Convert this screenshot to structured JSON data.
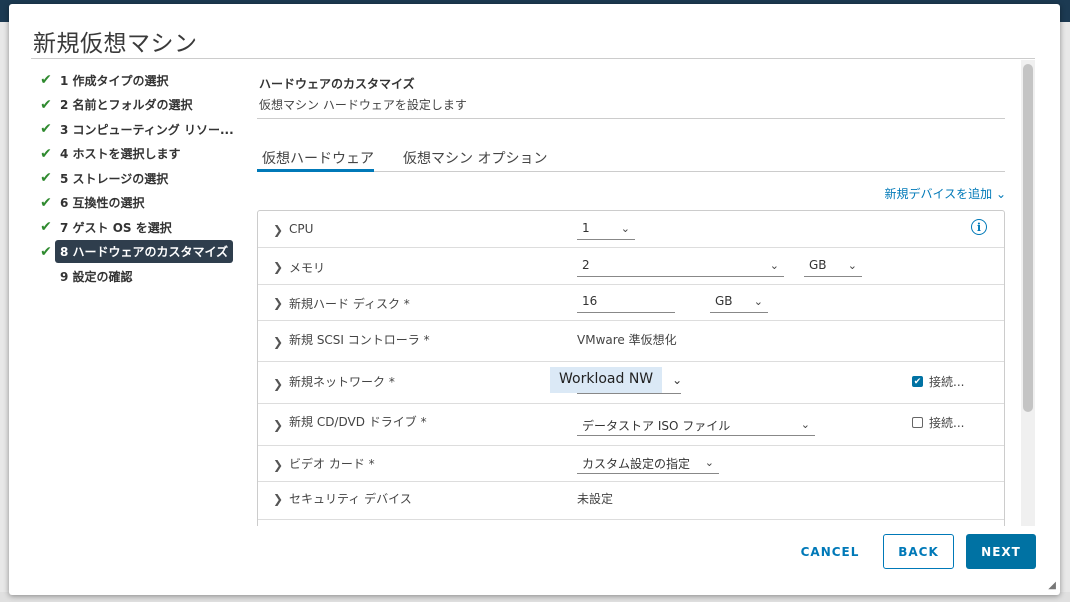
{
  "dialog": {
    "title": "新規仮想マシン"
  },
  "steps": [
    {
      "label": "1 作成タイプの選択",
      "done": true
    },
    {
      "label": "2 名前とフォルダの選択",
      "done": true
    },
    {
      "label": "3 コンピューティング リソー...",
      "done": true
    },
    {
      "label": "4 ホストを選択します",
      "done": true
    },
    {
      "label": "5 ストレージの選択",
      "done": true
    },
    {
      "label": "6 互換性の選択",
      "done": true
    },
    {
      "label": "7 ゲスト OS を選択",
      "done": true
    },
    {
      "label": "8 ハードウェアのカスタマイズ",
      "done": true,
      "active": true
    },
    {
      "label": "9 設定の確認",
      "done": false
    }
  ],
  "section": {
    "title": "ハードウェアのカスタマイズ",
    "subtitle": "仮想マシン ハードウェアを設定します"
  },
  "tabs": [
    {
      "label": "仮想ハードウェア",
      "active": true
    },
    {
      "label": "仮想マシン オプション",
      "active": false
    }
  ],
  "add_device": "新規デバイスを追加",
  "hardware": {
    "cpu": {
      "name": "CPU",
      "value": "1"
    },
    "memory": {
      "name": "メモリ",
      "value": "2",
      "unit": "GB"
    },
    "disk": {
      "name": "新規ハード ディスク *",
      "value": "16",
      "unit": "GB"
    },
    "scsi": {
      "name": "新規 SCSI コントローラ *",
      "value": "VMware 準仮想化"
    },
    "network": {
      "name": "新規ネットワーク *",
      "value": "Workload NW",
      "connect_label": "接続...",
      "connected": true
    },
    "cdrom": {
      "name": "新規 CD/DVD ドライブ *",
      "value": "データストア ISO ファイル",
      "connect_label": "接続...",
      "connected": false
    },
    "video": {
      "name": "ビデオ カード *",
      "value": "カスタム設定の指定"
    },
    "security": {
      "name": "セキュリティ デバイス",
      "value": "未設定"
    }
  },
  "buttons": {
    "cancel": "CANCEL",
    "back": "BACK",
    "next": "NEXT"
  },
  "colors": {
    "accent": "#0079b8",
    "primary_button": "#0072a3",
    "active_step": "#2f3e4d",
    "check": "#2f8a2f"
  }
}
